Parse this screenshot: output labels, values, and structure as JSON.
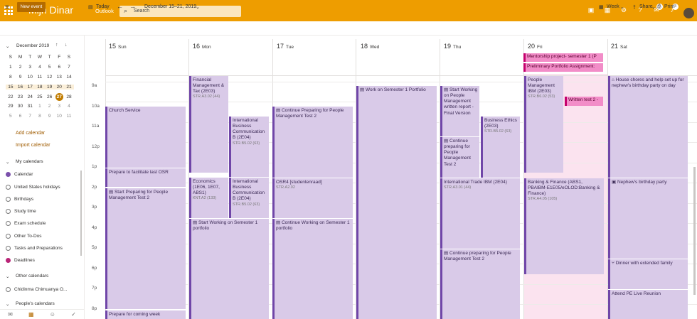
{
  "topbar": {
    "app_name": "Mijn Dinar",
    "product": "Outlook",
    "search_placeholder": "Search",
    "badge1": "6",
    "badge2": "3"
  },
  "cmdbar": {
    "new_event": "New event",
    "today": "Today",
    "range": "December 15–21, 2019",
    "view": "Week",
    "share": "Share",
    "print": "Print"
  },
  "minical": {
    "month": "December 2019",
    "weekdays": [
      "S",
      "M",
      "T",
      "W",
      "T",
      "F",
      "S"
    ],
    "weeks": [
      [
        "1",
        "2",
        "3",
        "4",
        "5",
        "6",
        "7"
      ],
      [
        "8",
        "9",
        "10",
        "11",
        "12",
        "13",
        "14"
      ],
      [
        "15",
        "16",
        "17",
        "18",
        "19",
        "20",
        "21"
      ],
      [
        "22",
        "23",
        "24",
        "25",
        "26",
        "27",
        "28"
      ],
      [
        "29",
        "30",
        "31",
        "1",
        "2",
        "3",
        "4"
      ],
      [
        "5",
        "6",
        "7",
        "8",
        "9",
        "10",
        "11"
      ]
    ],
    "today": "27"
  },
  "left": {
    "add_calendar": "Add calendar",
    "import_calendar": "Import calendar",
    "my_calendars": "My calendars",
    "calendars": [
      "Calendar",
      "United States holidays",
      "Birthdays",
      "Study time",
      "Exam schedule",
      "Other To-Dos",
      "Tasks and Preparations",
      "Deadlines"
    ],
    "other_calendars": "Other calendars",
    "other": [
      "Chidinma Chimuanya O..."
    ],
    "peoples": "People's calendars"
  },
  "days": [
    {
      "num": "15",
      "name": "Sun"
    },
    {
      "num": "16",
      "name": "Mon"
    },
    {
      "num": "17",
      "name": "Tue"
    },
    {
      "num": "18",
      "name": "Wed"
    },
    {
      "num": "19",
      "name": "Thu"
    },
    {
      "num": "20",
      "name": "Fri"
    },
    {
      "num": "21",
      "name": "Sat"
    }
  ],
  "hours": [
    "9a",
    "10a",
    "11a",
    "12p",
    "1p",
    "2p",
    "3p",
    "4p",
    "5p",
    "6p",
    "7p",
    "8p"
  ],
  "allday": {
    "fri1": "Mentorship project- semester 1 (P",
    "fri2": "Preliminary Portfolio Assignment:"
  },
  "events": {
    "sun1": "Church Service",
    "sun2": "Prepare to facilitate last OSR",
    "sun3": "Start Preparing for People Management Test 2",
    "sun4": "Prepare for coming week",
    "mon1": "Financial Management & Tax (2E03)",
    "mon1_loc": "STR.A3.02 (44)",
    "mon2": "International Business Communication B (2E04)",
    "mon2_loc": "STR.B5.02 (63)",
    "mon3": "Economics (1E06, 1E07, ABS1)",
    "mon3_loc": "KNT.A2 (133)",
    "mon4": "International Business Communication B (2E04)",
    "mon4_loc": "STR.B5.02 (63)",
    "mon5": "Start Working on Semester 1 portfolio",
    "tue1": "Continue Preparing for People Management Test 2",
    "tue2": "OSR4 [studentenraad]",
    "tue2_loc": "STR.A2.02",
    "tue3": "Continue Working on Semester 1 portfolio",
    "wed1": "Work on Semester 1 Portfolio",
    "thu1": "Start Working on People Management written report - Final Version",
    "thu2": "Business Ethics (2E03)",
    "thu2_loc": "STR.B5.02 (63)",
    "thu3": "Continue preparing for People Management Test 2",
    "thu4": "International Trade IBM (2E04)",
    "thu4_loc": "STR.A3.01 (44)",
    "thu5": "Continue preparing for People Management Test 2",
    "fri1": "People Management IBM (2E03)",
    "fri1_loc": "STR.B6.02 (53)",
    "fri2": "Written test 2 -",
    "fri3": "Banking & Finance (ABS1, PBAIBM-E1E05/eOLOD:Banking & Finance)",
    "fri3_loc": "STR.A4.05 (105)",
    "sat1": "House chores and help set up for nephew's birthday party on day",
    "sat2": "Nephew's birthday party",
    "sat3": "Dinner with extended family",
    "sat4": "Attend PE Live Reunion"
  }
}
